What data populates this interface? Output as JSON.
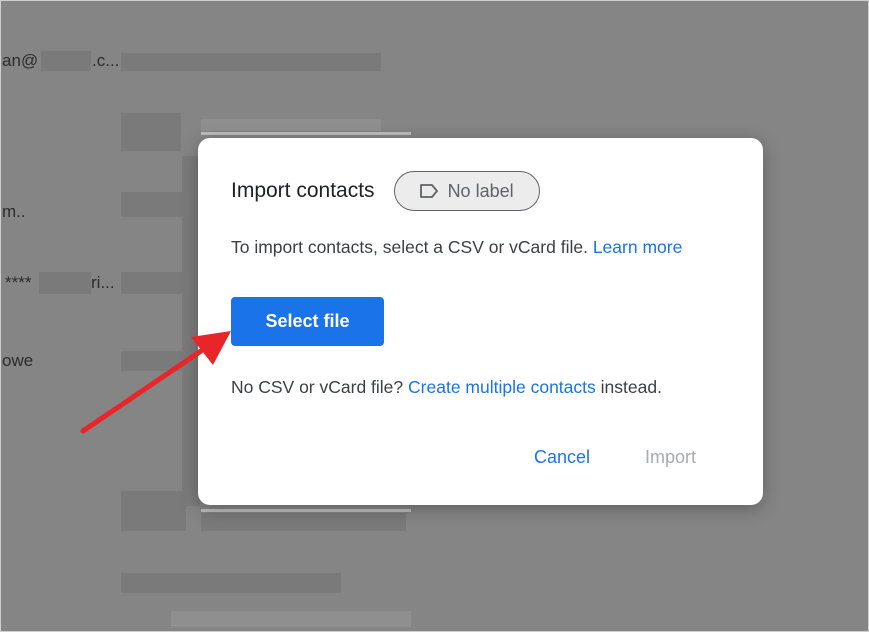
{
  "background": {
    "rows": [
      {
        "text": "an@"
      },
      {
        "text": ".c..."
      },
      {
        "text": "m.."
      },
      {
        "text": "****"
      },
      {
        "text": "ri..."
      },
      {
        "text": "owe"
      }
    ]
  },
  "dialog": {
    "title": "Import contacts",
    "label_chip": {
      "text": "No label",
      "icon": "label-outline-icon"
    },
    "description": "To import contacts, select a CSV or vCard file.",
    "learn_more": "Learn more",
    "select_file": "Select file",
    "alt_prefix": "No CSV or vCard file?",
    "alt_link": "Create multiple contacts",
    "alt_suffix": "instead.",
    "cancel": "Cancel",
    "import": "Import"
  },
  "colors": {
    "accent": "#1a73e8",
    "annotation_arrow": "#e8262a",
    "overlay": "#858585"
  }
}
